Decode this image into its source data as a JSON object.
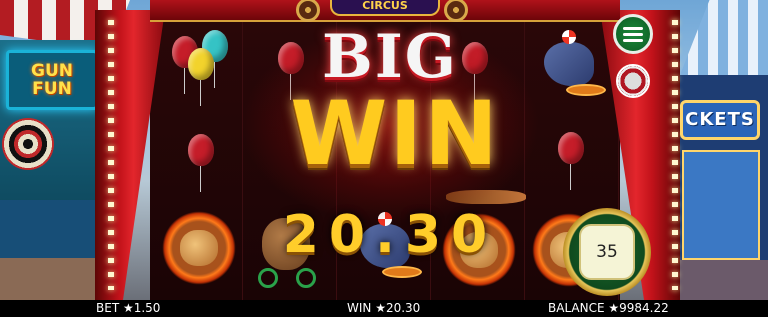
{
  "game": {
    "logo_text": "CIRCUS"
  },
  "scenery": {
    "left_sign_line1": "GUN",
    "left_sign_line2": "FUN",
    "right_sign": "CKETS"
  },
  "win_banner": {
    "big": "BIG",
    "win": "WIN",
    "amount": "20.30"
  },
  "controls": {
    "spin_value": "35"
  },
  "status_bar": {
    "bet": "BET ★1.50",
    "win": "WIN ★20.30",
    "balance": "BALANCE ★9984.22"
  },
  "icons": {
    "menu": "hamburger-menu-icon",
    "chips": "chip-stack-icon"
  },
  "colors": {
    "menu_green": "#1a8a3a",
    "win_gold": "#ffcb1f",
    "big_white": "#f5f5f5",
    "curtain_red": "#c2121a"
  }
}
